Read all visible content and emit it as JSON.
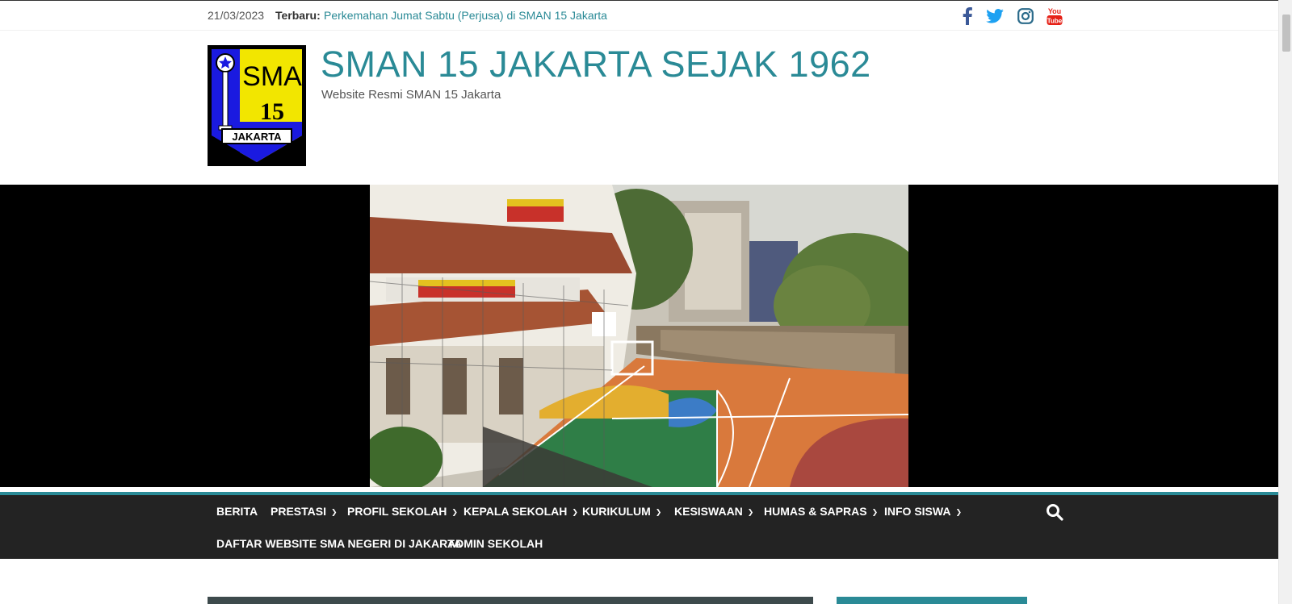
{
  "topbar": {
    "date": "21/03/2023",
    "latest_label": "Terbaru:",
    "latest_link": "Perkemahan Jumat Sabtu (Perjusa) di SMAN 15 Jakarta",
    "social_icons": [
      "facebook-icon",
      "twitter-icon",
      "instagram-icon",
      "youtube-icon"
    ]
  },
  "header": {
    "logo_text_top": "SMA",
    "logo_text_number": "15",
    "logo_text_bottom": "JAKARTA",
    "title": "SMAN 15 JAKARTA SEJAK 1962",
    "description": "Website Resmi SMAN 15 Jakarta"
  },
  "nav": {
    "items_row1": [
      {
        "label": "BERITA",
        "has_dropdown": false
      },
      {
        "label": "PRESTASI",
        "has_dropdown": true
      },
      {
        "label": "PROFIL SEKOLAH",
        "has_dropdown": true
      },
      {
        "label": "KEPALA SEKOLAH",
        "has_dropdown": true
      },
      {
        "label": "KURIKULUM",
        "has_dropdown": true
      },
      {
        "label": "KESISWAAN",
        "has_dropdown": true
      },
      {
        "label": "HUMAS & SAPRAS",
        "has_dropdown": true
      },
      {
        "label": "INFO SISWA",
        "has_dropdown": true
      }
    ],
    "items_row2": [
      {
        "label": "DAFTAR WEBSITE SMA NEGERI DI JAKARTA",
        "has_dropdown": false
      },
      {
        "label": "ADMIN SEKOLAH",
        "has_dropdown": false
      }
    ],
    "search_icon": "search-icon"
  },
  "colors": {
    "accent": "#2a8a96",
    "nav_bg": "#232323",
    "facebook": "#3b5998",
    "twitter": "#1da1f2",
    "instagram": "#2a6a8a",
    "youtube": "#e62117"
  }
}
